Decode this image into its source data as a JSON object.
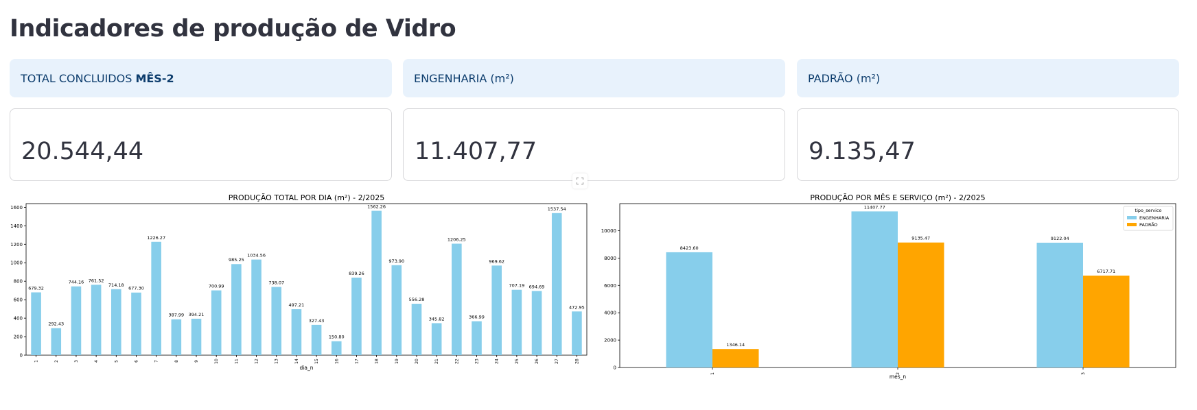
{
  "page": {
    "title": "Indicadores de produção de Vidro"
  },
  "info": {
    "total_prefix": "TOTAL CONCLUIDOS ",
    "total_bold": "MÊS-2",
    "engenharia": "ENGENHARIA (m²)",
    "padrao": "PADRÃO (m²)"
  },
  "metrics": {
    "total": "20.544,44",
    "engenharia": "11.407,77",
    "padrao": "9.135,47"
  },
  "icons": {
    "fullscreen": "fullscreen-icon"
  },
  "colors": {
    "engenharia": "#87ceeb",
    "padrao": "#ffa500",
    "info_bg": "#e8f2fc",
    "info_text": "#0d3d6d"
  },
  "chart_data": [
    {
      "type": "bar",
      "title": "PRODUÇÃO TOTAL POR DIA (m²) - 2/2025",
      "xlabel": "dia_n",
      "ylabel": "",
      "categories": [
        "1",
        "2",
        "3",
        "4",
        "5",
        "6",
        "7",
        "8",
        "9",
        "10",
        "11",
        "12",
        "13",
        "14",
        "15",
        "16",
        "17",
        "18",
        "19",
        "20",
        "21",
        "22",
        "23",
        "24",
        "25",
        "26",
        "27",
        "28"
      ],
      "values": [
        679.32,
        292.43,
        744.16,
        761.52,
        714.18,
        677.3,
        1226.27,
        387.99,
        394.21,
        700.99,
        985.25,
        1034.56,
        738.07,
        497.21,
        327.43,
        150.8,
        839.26,
        1562.26,
        973.9,
        556.28,
        345.82,
        1206.25,
        366.99,
        969.62,
        707.19,
        694.69,
        1537.54,
        472.95
      ],
      "value_labels": [
        "679.32",
        "292.43",
        "744.16",
        "761.52",
        "714.18",
        "677.30",
        "1226.27",
        "387.99",
        "394.21",
        "700.99",
        "985.25",
        "1034.56",
        "738.07",
        "497.21",
        "327.43",
        "150.80",
        "839.26",
        "1562.26",
        "973.90",
        "556.28",
        "345.82",
        "1206.25",
        "366.99",
        "969.62",
        "707.19",
        "694.69",
        "1537.54",
        "472.95"
      ],
      "yticks": [
        0,
        200,
        400,
        600,
        800,
        1000,
        1200,
        1400,
        1600
      ],
      "ylim": [
        0,
        1640
      ],
      "color": "#87ceeb",
      "grid": false
    },
    {
      "type": "bar",
      "title": "PRODUÇÃO POR MÊS E SERVIÇO (m²) - 2/2025",
      "xlabel": "mes_n",
      "ylabel": "",
      "categories": [
        "1",
        "2",
        "3"
      ],
      "series": [
        {
          "name": "ENGENHARIA",
          "values": [
            8423.6,
            11407.77,
            9122.04
          ],
          "labels": [
            "8423.60",
            "11407.77",
            "9122.04"
          ],
          "color": "#87ceeb"
        },
        {
          "name": "PADRÃO",
          "values": [
            1346.14,
            9135.47,
            6717.71
          ],
          "labels": [
            "1346.14",
            "9135.47",
            "6717.71"
          ],
          "color": "#ffa500"
        }
      ],
      "legend_title": "tipo_servico",
      "legend_position": "top-right",
      "yticks": [
        0,
        2000,
        4000,
        6000,
        8000,
        10000
      ],
      "ylim": [
        0,
        11978
      ],
      "grid": false
    }
  ]
}
